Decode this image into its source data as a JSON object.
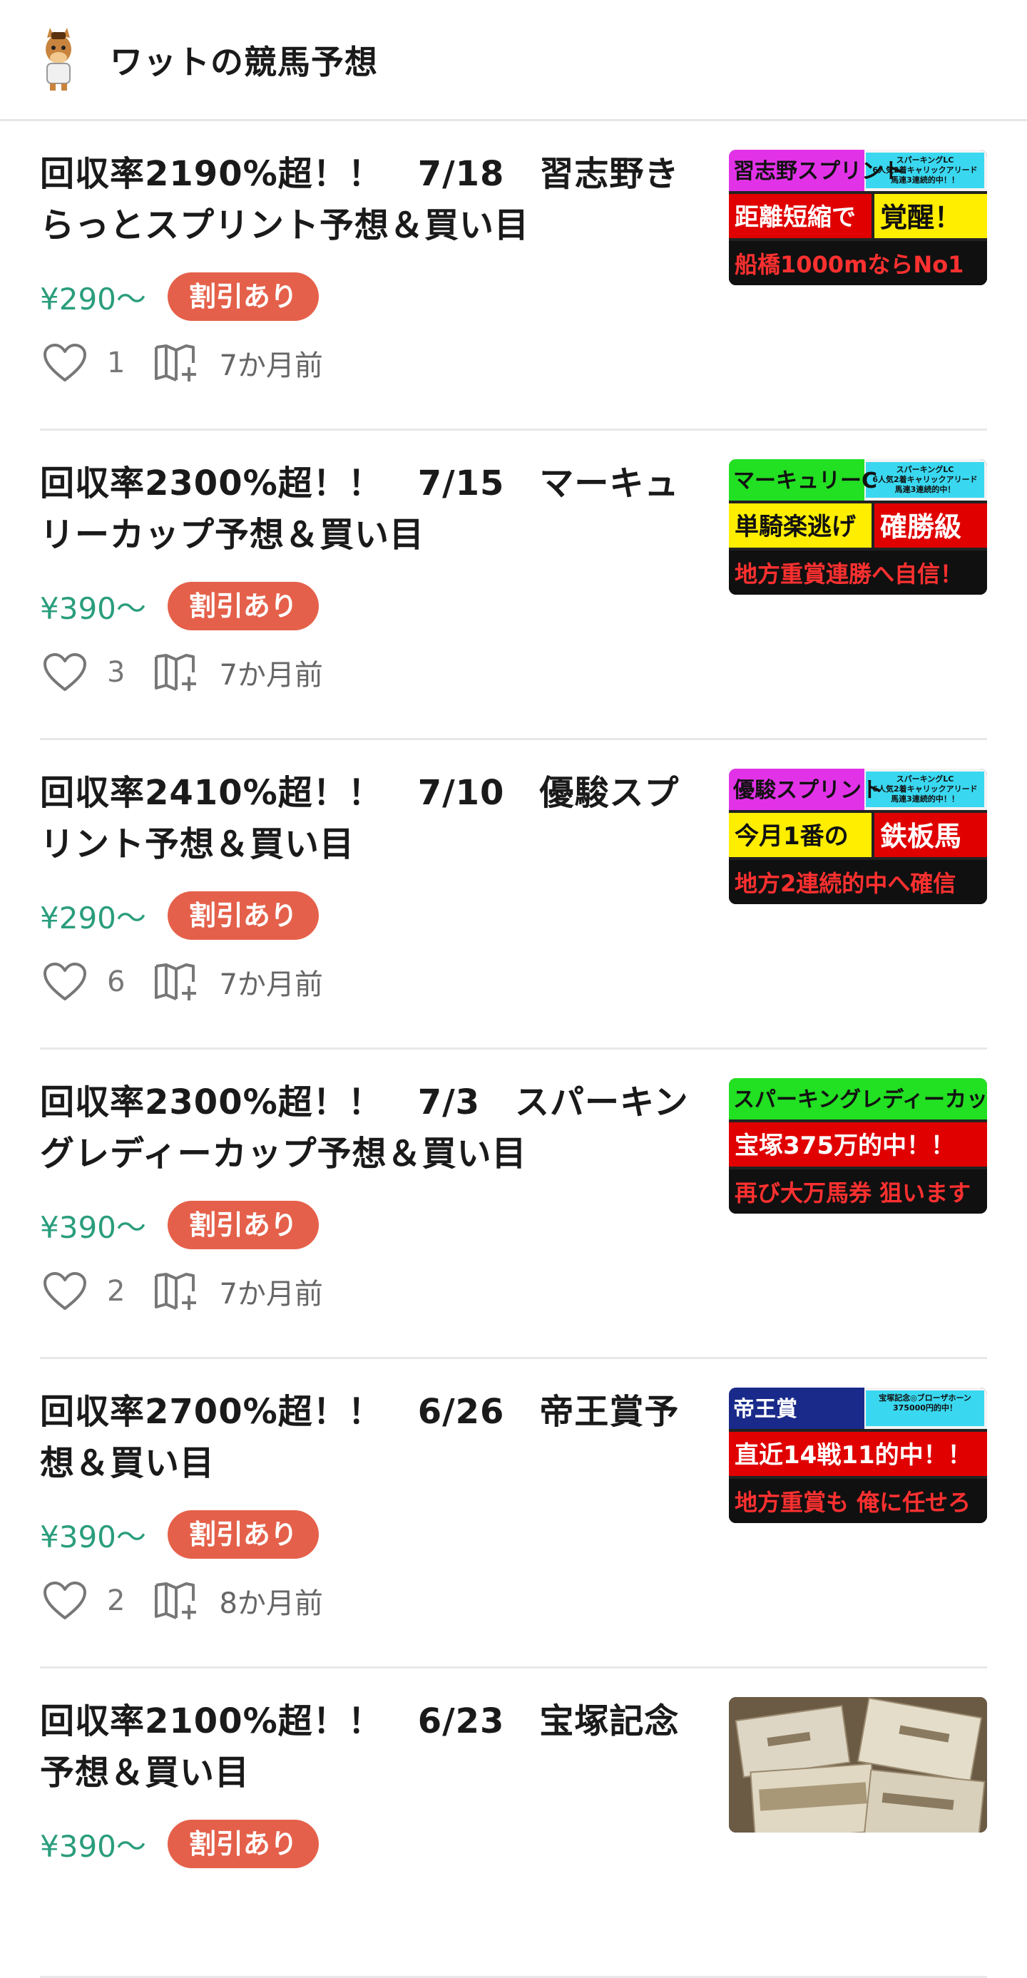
{
  "header": {
    "title": "ワットの競馬予想",
    "avatar_icon": "horse-mascot-icon"
  },
  "articles": [
    {
      "title": "回収率2190%超！！　7/18　習志野き\nらっとスプリント予想＆買い目",
      "price": "¥290〜",
      "badge": "割引あり",
      "likes": "1",
      "age": "7か月前",
      "thumb": {
        "tag": "習志野スプリント",
        "note1": "スパーキングLC",
        "note2": "6人気2着キャリックアリード",
        "note3": "馬連3連続的中！！",
        "line1": "距離短縮で",
        "line1b": "覚醒！",
        "line2": "船橋1000mならNo1",
        "tag_color": "#e232e8",
        "line1_color": "#e00000",
        "line1b_color": "#ffee00"
      }
    },
    {
      "title": "回収率2300%超！！　7/15　マーキュ\nリーカップ予想＆買い目",
      "price": "¥390〜",
      "badge": "割引あり",
      "likes": "3",
      "age": "7か月前",
      "thumb": {
        "tag": "マーキュリーC",
        "note1": "スパーキングLC",
        "note2": "6人気2着キャリックアリード",
        "note3": "馬連3連続的中！",
        "line1": "単騎楽逃げ",
        "line1b": "確勝級",
        "line2": "地方重賞連勝へ自信！",
        "tag_color": "#22e022",
        "line1_color": "#ffee00",
        "line1b_color": "#e00000"
      }
    },
    {
      "title": "回収率2410%超！！　7/10　優駿スプ\nリント予想＆買い目",
      "price": "¥290〜",
      "badge": "割引あり",
      "likes": "6",
      "age": "7か月前",
      "thumb": {
        "tag": "優駿スプリント",
        "note1": "スパーキングLC",
        "note2": "6人気2着キャリックアリード",
        "note3": "馬連3連続的中！！",
        "line1": "今月1番の",
        "line1b": "鉄板馬",
        "line2": "地方2連続的中へ確信",
        "tag_color": "#e232e8",
        "line1_color": "#ffee00",
        "line1b_color": "#e00000"
      }
    },
    {
      "title": "回収率2300%超！！　7/3　スパーキン\nグレディーカップ予想＆買い目",
      "price": "¥390〜",
      "badge": "割引あり",
      "likes": "2",
      "age": "7か月前",
      "thumb": {
        "tag": "スパーキングレディーカップ",
        "note1": "",
        "note2": "",
        "note3": "",
        "line1": "宝塚375万的中！！",
        "line1b": "",
        "line2": "再び大万馬券 狙います",
        "tag_color": "#22e022",
        "line1_color": "#e00000",
        "line1b_color": "#e00000"
      }
    },
    {
      "title": "回収率2700%超！！　6/26　帝王賞予\n想＆買い目",
      "price": "¥390〜",
      "badge": "割引あり",
      "likes": "2",
      "age": "8か月前",
      "thumb": {
        "tag": "帝王賞",
        "note1": "宝塚記念◎ブローザホーン",
        "note2": "375000円的中！",
        "note3": "",
        "line1": "直近14戦11的中！！",
        "line1b": "",
        "line2": "地方重賞も 俺に任せろ",
        "tag_color": "#1a2a8a",
        "line1_color": "#e00000",
        "line1b_color": "#e00000"
      }
    },
    {
      "title": "回収率2100%超！！　6/23　宝塚記念\n予想＆買い目",
      "price": "¥390〜",
      "badge": "割引あり",
      "likes": "",
      "age": "",
      "thumb": {
        "tag": "",
        "note1": "",
        "note2": "",
        "note3": "",
        "line1": "",
        "line1b": "",
        "line2": "",
        "tag_color": "#8a7a60",
        "line1_color": "#8a7a60",
        "line1b_color": "#8a7a60",
        "photo": "banknote-stack-photo"
      }
    }
  ]
}
